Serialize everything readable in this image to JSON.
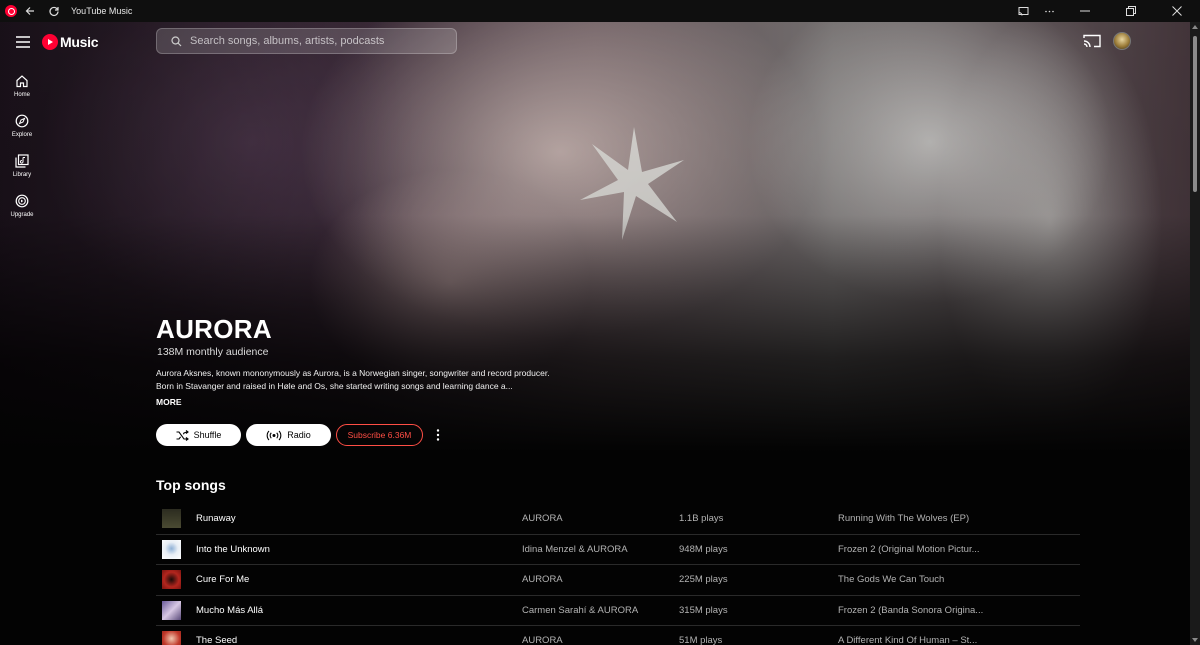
{
  "window": {
    "title": "YouTube Music"
  },
  "header": {
    "logo_text": "Music",
    "search_placeholder": "Search songs, albums, artists, podcasts"
  },
  "sidebar": {
    "items": [
      {
        "label": "Home",
        "icon": "home-icon"
      },
      {
        "label": "Explore",
        "icon": "compass-icon"
      },
      {
        "label": "Library",
        "icon": "library-icon"
      },
      {
        "label": "Upgrade",
        "icon": "upgrade-icon"
      }
    ]
  },
  "artist": {
    "name": "AURORA",
    "audience": "138M monthly audience",
    "bio": "Aurora Aksnes, known mononymously as Aurora, is a Norwegian singer, songwriter and record producer. Born in Stavanger and raised in Høle and Os, she started writing songs and learning dance a...",
    "more_label": "MORE"
  },
  "actions": {
    "shuffle_label": "Shuffle",
    "radio_label": "Radio",
    "subscribe_label": "Subscribe 6.36M"
  },
  "top_songs": {
    "title": "Top songs",
    "rows": [
      {
        "title": "Runaway",
        "artist": "AURORA",
        "plays": "1.1B plays",
        "album": "Running With The Wolves (EP)",
        "thumb_color": "#3a3a2a"
      },
      {
        "title": "Into the Unknown",
        "artist": "Idina Menzel & AURORA",
        "plays": "948M plays",
        "album": "Frozen 2 (Original Motion Pictur...",
        "thumb_color": "#e8eef5"
      },
      {
        "title": "Cure For Me",
        "artist": "AURORA",
        "plays": "225M plays",
        "album": "The Gods We Can Touch",
        "thumb_color": "#b3261e"
      },
      {
        "title": "Mucho Más Allá",
        "artist": "Carmen Sarahí & AURORA",
        "plays": "315M plays",
        "album": "Frozen 2 (Banda Sonora Origina...",
        "thumb_color": "#c9b7d6"
      },
      {
        "title": "The Seed",
        "artist": "AURORA",
        "plays": "51M plays",
        "album": "A Different Kind Of Human – St...",
        "thumb_color": "#c0392b"
      }
    ]
  },
  "colors": {
    "accent": "#ff0033",
    "subscribe": "#ff4e45",
    "background": "#030303"
  }
}
